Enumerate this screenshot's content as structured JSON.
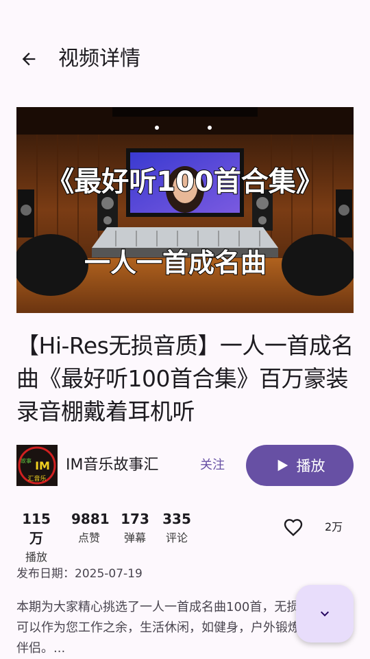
{
  "header": {
    "title": "视频详情",
    "back_icon": "arrow-left-icon"
  },
  "video": {
    "thumbnail": {
      "headline": "《最好听100首合集》",
      "subline": "一人一首成名曲"
    },
    "title": "【Hi-Res无损音质】一人一首成名曲《最好听100首合集》百万豪装录音棚戴着耳机听"
  },
  "author": {
    "avatar_text_main": "IM",
    "avatar_text_side": "故事",
    "avatar_text_sub": "汇音乐",
    "name": "IM音乐故事汇",
    "follow_label": "关注"
  },
  "play_button": {
    "label": "播放",
    "icon": "play-icon"
  },
  "stats": [
    {
      "value": "115万",
      "label": "播放"
    },
    {
      "value": "9881",
      "label": "点赞"
    },
    {
      "value": "173",
      "label": "弹幕"
    },
    {
      "value": "335",
      "label": "评论"
    }
  ],
  "like": {
    "icon": "heart-outline-icon",
    "count": "2万"
  },
  "publish_date": "发布日期：2025-07-19",
  "description": "本期为大家精心挑选了一人一首成名曲100首，无损音质。可以作为您工作之余，生活休闲，如健身，户外锻炼的音乐伴侣。...",
  "fab": {
    "icon": "chevron-down-icon"
  },
  "colors": {
    "primary": "#6750a4",
    "fab_bg": "#e8ddfb",
    "background": "#fdf8fd"
  }
}
